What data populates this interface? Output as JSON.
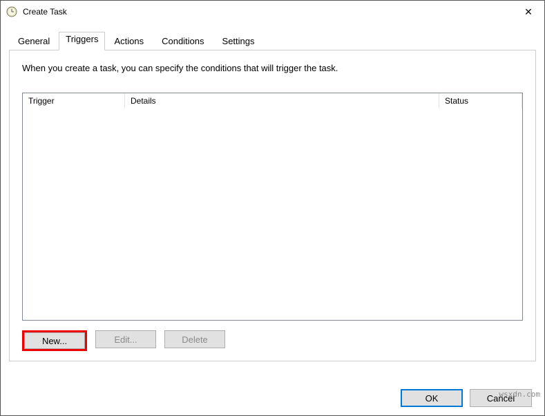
{
  "window": {
    "title": "Create Task"
  },
  "tabs": {
    "general": "General",
    "triggers": "Triggers",
    "actions": "Actions",
    "conditions": "Conditions",
    "settings": "Settings"
  },
  "panel": {
    "instruction": "When you create a task, you can specify the conditions that will trigger the task."
  },
  "table": {
    "cols": {
      "trigger": "Trigger",
      "details": "Details",
      "status": "Status"
    }
  },
  "buttons": {
    "new": "New...",
    "edit": "Edit...",
    "delete": "Delete",
    "ok": "OK",
    "cancel": "Cancel"
  },
  "watermark": "wsxdn.com"
}
